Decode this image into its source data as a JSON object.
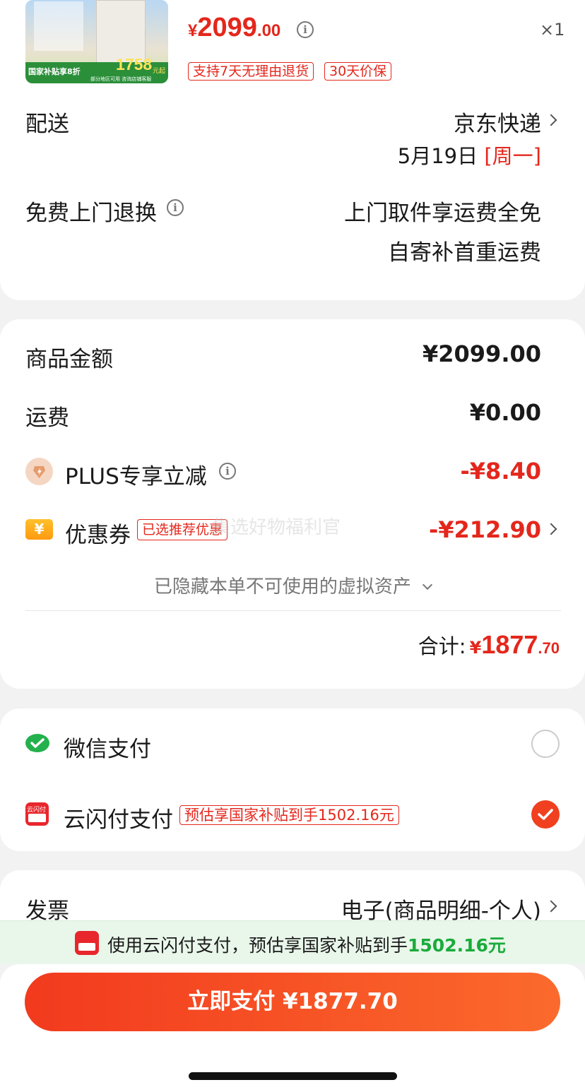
{
  "product": {
    "banner_text": "国家补贴享8折",
    "banner_price": "1758",
    "banner_price_unit": "元起",
    "banner_note": "部分地区可用 咨询店铺客服",
    "currency": "¥",
    "price_int": "2099",
    "price_dec": ".00",
    "quantity": "×1",
    "tags": [
      "支持7天无理由退货",
      "30天价保"
    ]
  },
  "delivery": {
    "label": "配送",
    "carrier": "京东快递",
    "date": "5月19日",
    "weekday": "[周一]"
  },
  "returns": {
    "label": "免费上门退换",
    "line1": "上门取件享运费全免",
    "line2": "自寄补首重运费"
  },
  "summary": {
    "goods_label": "商品金额",
    "goods_value": "¥2099.00",
    "shipping_label": "运费",
    "shipping_value": "¥0.00",
    "plus_label": "PLUS专享立减",
    "plus_value": "-¥8.40",
    "coupon_label": "优惠券",
    "coupon_tag": "已选推荐优惠",
    "coupon_value": "-¥212.90",
    "watermark": "集选好物福利官",
    "hidden_assets": "已隐藏本单不可使用的虚拟资产",
    "total_label": "合计:",
    "total_currency": "¥",
    "total_int": "1877",
    "total_dec": ".70"
  },
  "payment": {
    "wechat_label": "微信支付",
    "unionpay_label": "云闪付支付",
    "unionpay_tag": "预估享国家补贴到手1502.16元",
    "unionpay_icon_text": "云闪付",
    "selected": "unionpay"
  },
  "invoice": {
    "label": "发票",
    "value": "电子(商品明细-个人)"
  },
  "promo_bar": {
    "text_prefix": "使用云闪付支付，预估享国家补贴到手",
    "amount": "1502.16元"
  },
  "pay_button": {
    "label": "立即支付 ¥1877.70"
  },
  "colors": {
    "accent_red": "#e4271c",
    "button_gradient_start": "#f23a1e",
    "button_gradient_end": "#fb6a2c",
    "green_highlight": "#1aab3b"
  }
}
